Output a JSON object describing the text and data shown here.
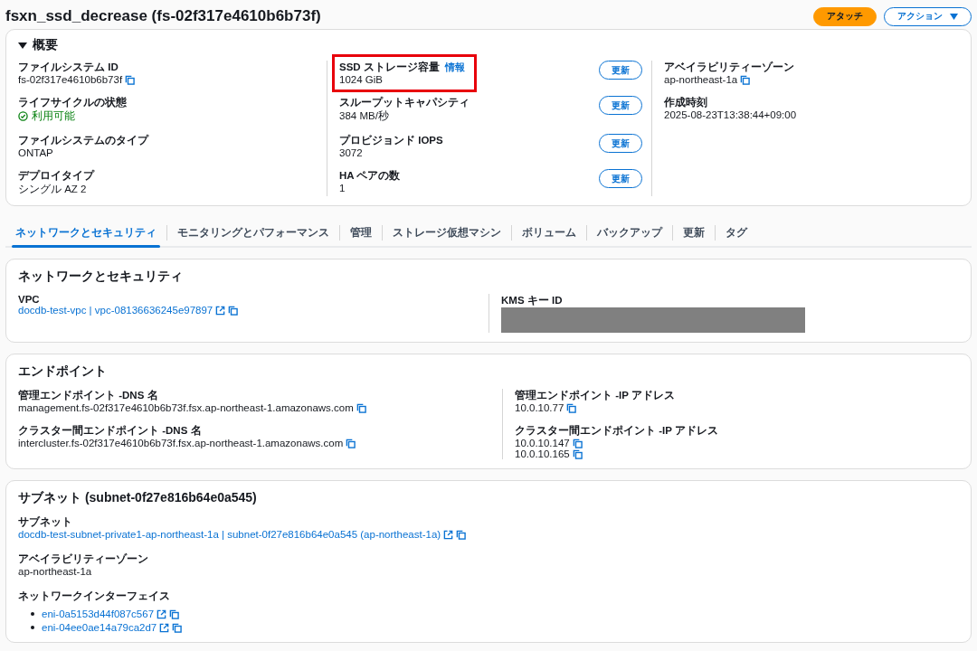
{
  "header": {
    "title": "fsxn_ssd_decrease (fs-02f317e4610b6b73f)",
    "buttons": [
      {
        "label": "アタッチ",
        "kind": "primary"
      },
      {
        "label": "アクション",
        "kind": "dropdown"
      }
    ]
  },
  "overview": {
    "title": "概要",
    "expanded": true,
    "columns": [
      [
        {
          "label": "ファイルシステム ID",
          "values": [
            {
              "text": "fs-02f317e4610b6b73f",
              "kind": "plain",
              "copy": true
            }
          ]
        },
        {
          "label": "ライフサイクルの状態",
          "values": [
            {
              "text": "利用可能",
              "kind": "status"
            }
          ]
        },
        {
          "label": "ファイルシステムのタイプ",
          "values": [
            {
              "text": "ONTAP",
              "kind": "plain"
            }
          ]
        },
        {
          "label": "デプロイタイプ",
          "values": [
            {
              "text": "シングル AZ 2",
              "kind": "plain"
            }
          ]
        }
      ],
      [
        {
          "label": "SSD ストレージ容量",
          "info": "情報",
          "highlighted": true,
          "values": [
            {
              "text": "1024 GiB",
              "kind": "plain"
            }
          ],
          "update": "更新"
        },
        {
          "label": "スループットキャパシティ",
          "values": [
            {
              "text": "384 MB/秒",
              "kind": "plain"
            }
          ],
          "update": "更新"
        },
        {
          "label": "プロビジョンド IOPS",
          "values": [
            {
              "text": "3072",
              "kind": "plain"
            }
          ],
          "update": "更新"
        },
        {
          "label": "HA ペアの数",
          "values": [
            {
              "text": "1",
              "kind": "plain"
            }
          ],
          "update": "更新"
        }
      ],
      [
        {
          "label": "アベイラビリティーゾーン",
          "values": [
            {
              "text": "ap-northeast-1a",
              "kind": "plain",
              "copy": true
            }
          ]
        },
        {
          "label": "作成時刻",
          "values": [
            {
              "text": "2025-08-23T13:38:44+09:00",
              "kind": "plain"
            }
          ]
        }
      ]
    ]
  },
  "tabs": [
    {
      "label": "ネットワークとセキュリティ",
      "selected": true
    },
    {
      "label": "モニタリングとパフォーマンス",
      "selected": false
    },
    {
      "label": "管理",
      "selected": false
    },
    {
      "label": "ストレージ仮想マシン",
      "selected": false
    },
    {
      "label": "ボリューム",
      "selected": false
    },
    {
      "label": "バックアップ",
      "selected": false
    },
    {
      "label": "更新",
      "selected": false
    },
    {
      "label": "タグ",
      "selected": false
    }
  ],
  "sections": [
    {
      "title": "ネットワークとセキュリティ",
      "columns": [
        [
          {
            "label": "VPC",
            "values": [
              {
                "text": "docdb-test-vpc | vpc-08136636245e97897",
                "kind": "link",
                "external": true,
                "copy": true
              }
            ]
          }
        ],
        [
          {
            "label": "KMS キー ID",
            "redacted": true
          }
        ]
      ]
    },
    {
      "title": "エンドポイント",
      "columns": [
        [
          {
            "label": "管理エンドポイント -DNS 名",
            "values": [
              {
                "text": "management.fs-02f317e4610b6b73f.fsx.ap-northeast-1.amazonaws.com",
                "kind": "plain",
                "copy": true
              }
            ]
          },
          {
            "label": "クラスター間エンドポイント -DNS 名",
            "values": [
              {
                "text": "intercluster.fs-02f317e4610b6b73f.fsx.ap-northeast-1.amazonaws.com",
                "kind": "plain",
                "copy": true
              }
            ]
          }
        ],
        [
          {
            "label": "管理エンドポイント -IP アドレス",
            "values": [
              {
                "text": "10.0.10.77",
                "kind": "plain",
                "copy": true
              }
            ]
          },
          {
            "label": "クラスター間エンドポイント -IP アドレス",
            "values": [
              {
                "text": "10.0.10.147",
                "kind": "plain",
                "copy": true
              },
              {
                "text": "10.0.10.165",
                "kind": "plain",
                "copy": true
              }
            ]
          }
        ]
      ]
    },
    {
      "title": "サブネット (subnet-0f27e816b64e0a545)",
      "columns": [
        [
          {
            "label": "サブネット",
            "values": [
              {
                "text": "docdb-test-subnet-private1-ap-northeast-1a | subnet-0f27e816b64e0a545 (ap-northeast-1a)",
                "kind": "link",
                "external": true,
                "copy": true
              }
            ]
          },
          {
            "label": "アベイラビリティーゾーン",
            "values": [
              {
                "text": "ap-northeast-1a",
                "kind": "plain"
              }
            ]
          },
          {
            "label": "ネットワークインターフェイス",
            "bulleted": true,
            "values": [
              {
                "text": "eni-0a5153d44f087c567",
                "kind": "link",
                "external": true,
                "copy": true
              },
              {
                "text": "eni-04ee0ae14a79ca2d7",
                "kind": "link",
                "external": true,
                "copy": true
              }
            ]
          }
        ]
      ]
    }
  ]
}
